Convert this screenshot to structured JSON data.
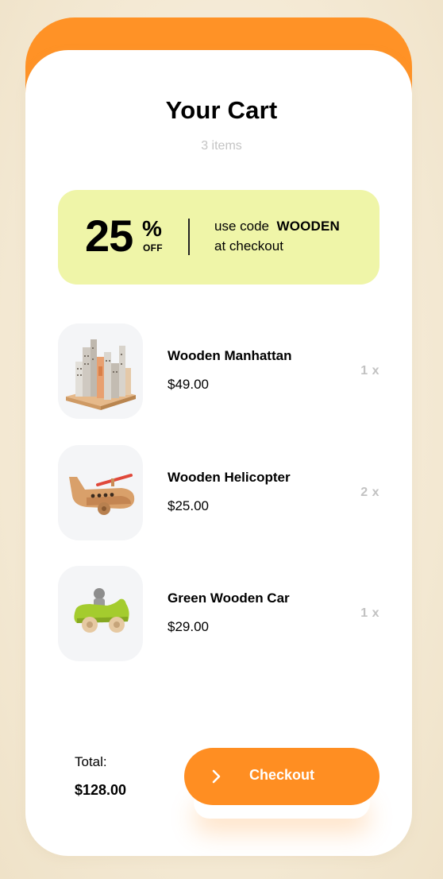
{
  "cart": {
    "title": "Your Cart",
    "subtitle": "3 items"
  },
  "promo": {
    "discount": "25",
    "percent_sign": "%",
    "off_label": "OFF",
    "text_prefix": "use code",
    "code": "WOODEN",
    "text_suffix": "at checkout",
    "background_color": "#eff5a8"
  },
  "items": [
    {
      "name": "Wooden Manhattan",
      "price": "$49.00",
      "quantity": "1 x",
      "image_icon": "wooden-city-blocks-icon"
    },
    {
      "name": "Wooden Helicopter",
      "price": "$25.00",
      "quantity": "2 x",
      "image_icon": "wooden-helicopter-icon"
    },
    {
      "name": "Green Wooden Car",
      "price": "$29.00",
      "quantity": "1 x",
      "image_icon": "green-wooden-car-icon"
    }
  ],
  "summary": {
    "total_label": "Total:",
    "total_value": "$128.00"
  },
  "checkout": {
    "label": "Checkout",
    "icon": "chevron-right-icon"
  },
  "colors": {
    "accent": "#ff8e22",
    "background": "#f4ecdb",
    "card": "#ffffff",
    "muted_text": "#c4c4c4"
  }
}
